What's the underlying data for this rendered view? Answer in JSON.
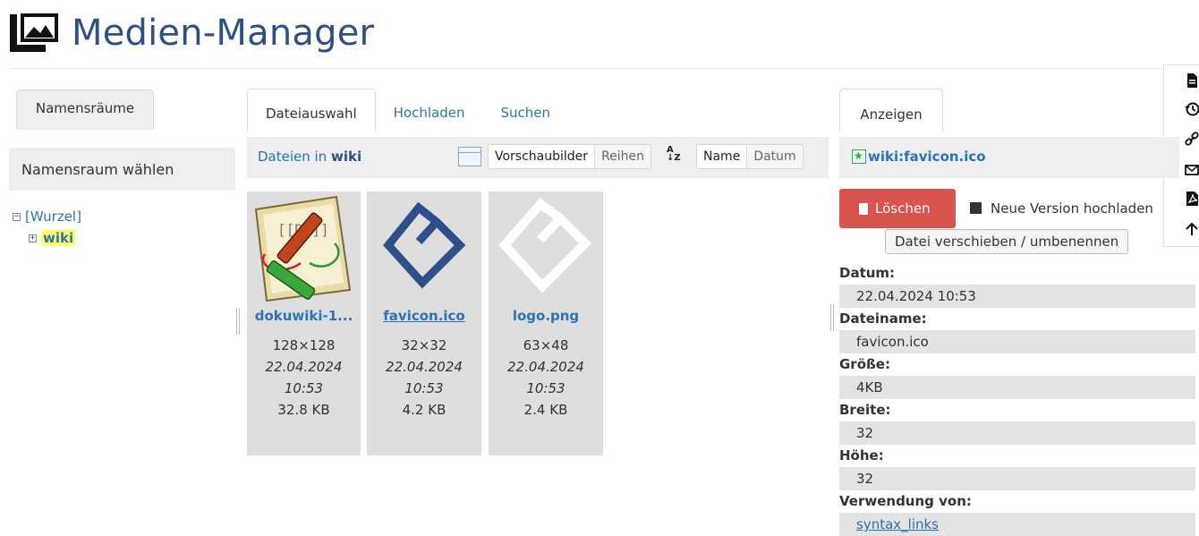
{
  "page": {
    "title": "Medien-Manager"
  },
  "pagetools": [
    "document-icon",
    "history-icon",
    "link-icon",
    "mail-icon",
    "pdf-icon",
    "arrow-up-icon"
  ],
  "namespaces": {
    "tab_label": "Namensräume",
    "header": "Namensraum wählen",
    "tree": {
      "root_label": "[Wurzel]",
      "child_label": "wiki"
    }
  },
  "files": {
    "tabs": [
      "Dateiauswahl",
      "Hochladen",
      "Suchen"
    ],
    "bar": {
      "prefix": "Dateien in ",
      "namespace": "wiki",
      "view_options": [
        "Vorschaubilder",
        "Reihen"
      ],
      "sort_options": [
        "Name",
        "Datum"
      ]
    },
    "items": [
      {
        "name": "dokuwiki-1...",
        "dims": "128×128",
        "date": "22.04.2024",
        "time": "10:53",
        "size": "32.8 KB"
      },
      {
        "name": "favicon.ico",
        "dims": "32×32",
        "date": "22.04.2024",
        "time": "10:53",
        "size": "4.2 KB"
      },
      {
        "name": "logo.png",
        "dims": "63×48",
        "date": "22.04.2024",
        "time": "10:53",
        "size": "2.4 KB"
      }
    ]
  },
  "detail": {
    "tab_label": "Anzeigen",
    "file_id": "wiki:favicon.ico",
    "buttons": {
      "delete": "Löschen",
      "upload_new": "Neue Version hochladen",
      "move": "Datei verschieben / umbenennen"
    },
    "props": [
      {
        "label": "Datum:",
        "value": "22.04.2024 10:53"
      },
      {
        "label": "Dateiname:",
        "value": "favicon.ico"
      },
      {
        "label": "Größe:",
        "value": "4KB"
      },
      {
        "label": "Breite:",
        "value": "32"
      },
      {
        "label": "Höhe:",
        "value": "32"
      },
      {
        "label": "Verwendung von:",
        "value": "syntax_links"
      }
    ]
  },
  "colors": {
    "link": "#2b73b7",
    "title": "#2f4f8a",
    "danger": "#d9534f",
    "highlight": "#ffff66",
    "panel": "#eeeeee"
  }
}
